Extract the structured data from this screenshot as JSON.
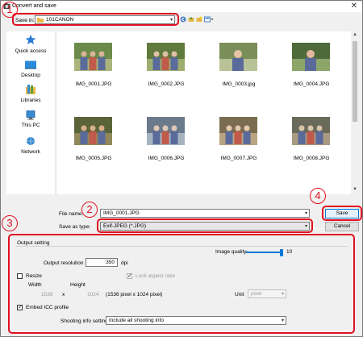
{
  "window": {
    "title": "Convert and save",
    "close_glyph": "✕"
  },
  "toolbar": {
    "save_in_label": "Save in:",
    "save_in_value": "101CANON",
    "arrow": "▾"
  },
  "sidebar": {
    "items": [
      {
        "label": "Quick access",
        "icon": "star-icon"
      },
      {
        "label": "Desktop",
        "icon": "desktop-icon"
      },
      {
        "label": "Libraries",
        "icon": "libraries-icon"
      },
      {
        "label": "This PC",
        "icon": "pc-icon"
      },
      {
        "label": "Network",
        "icon": "network-icon"
      }
    ]
  },
  "files": [
    {
      "name": "IMG_0001.JPG",
      "palette": [
        "#6c8a4a",
        "#a9b57a",
        "#d9b49a"
      ]
    },
    {
      "name": "IMG_0002.JPG",
      "palette": [
        "#5f7a3c",
        "#9cad6f",
        "#e0c0a8"
      ]
    },
    {
      "name": "IMG_0003.jpg",
      "palette": [
        "#7a8e5a",
        "#b9c296",
        "#e6c3a6"
      ]
    },
    {
      "name": "IMG_0004.JPG",
      "palette": [
        "#4e6a3a",
        "#8ea56a",
        "#e2b9a0"
      ]
    },
    {
      "name": "IMG_0005.JPG",
      "palette": [
        "#5a6438",
        "#90885a",
        "#d8b08a"
      ]
    },
    {
      "name": "IMG_0006.JPG",
      "palette": [
        "#6a7a8a",
        "#a7b4c0",
        "#e0c8b8"
      ]
    },
    {
      "name": "IMG_0007.JPG",
      "palette": [
        "#7a6c50",
        "#b9a482",
        "#e4cbb0"
      ]
    },
    {
      "name": "IMG_0008.JPG",
      "palette": [
        "#6a6a5a",
        "#a89a80",
        "#d8c4a8"
      ]
    }
  ],
  "save_fields": {
    "filename_label": "File name:",
    "filename_value": "IMG_0001.JPG",
    "saveas_label": "Save as type:",
    "saveas_value": "Exif-JPEG (*.JPG)",
    "save_button": "Save",
    "cancel_button": "Cancel"
  },
  "output": {
    "group_title": "Output setting",
    "image_quality_label": "Image quality",
    "image_quality_value": "10",
    "image_quality_level": 1.0,
    "resolution_label": "Output resolution",
    "resolution_value": "350",
    "resolution_unit": "dpi",
    "resize_label": "Resize",
    "lock_aspect_label": "Lock aspect ratio",
    "width_label": "Width",
    "height_label": "Height",
    "width_value": "1536",
    "x_sep": "x",
    "height_value": "1024",
    "size_info": "(1536 pixel x 1024 pixel)",
    "unit_label": "Unit",
    "unit_value": "pixel",
    "embed_icc_label": "Embed ICC profile",
    "shooting_info_label": "Shooting info setting",
    "shooting_info_value": "Include all shooting info"
  },
  "callouts": [
    "1",
    "2",
    "3",
    "4"
  ],
  "colors": {
    "accent": "#0078d7",
    "callout": "#e01020"
  }
}
